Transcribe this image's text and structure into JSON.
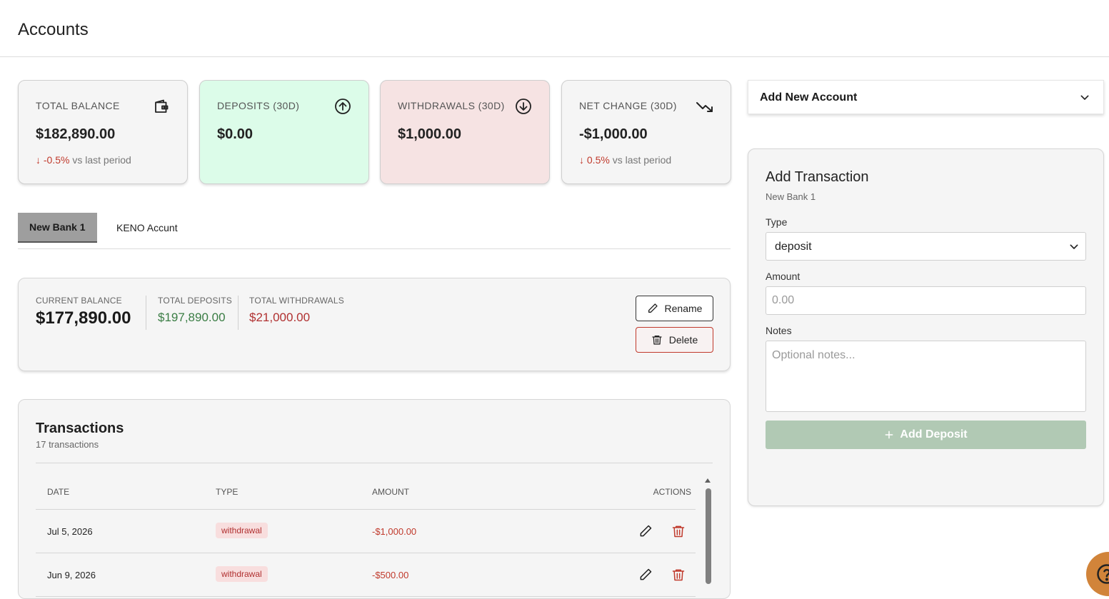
{
  "header": {
    "title": "Accounts"
  },
  "stats": [
    {
      "label": "TOTAL BALANCE",
      "value": "$182,890.00",
      "change_arrow": "↓",
      "change_value": "-0.5%",
      "change_suffix": "vs last period",
      "icon": "wallet-icon"
    },
    {
      "label": "DEPOSITS (30D)",
      "value": "$0.00",
      "icon": "arrow-up-circle-icon",
      "bg": "#dcfce9"
    },
    {
      "label": "WITHDRAWALS (30D)",
      "value": "$1,000.00",
      "icon": "arrow-down-circle-icon",
      "bg": "#f6e3e3"
    },
    {
      "label": "NET CHANGE (30D)",
      "value": "-$1,000.00",
      "change_arrow": "↓",
      "change_value": "0.5%",
      "change_suffix": "vs last period",
      "icon": "trending-down-icon"
    }
  ],
  "tabs": [
    {
      "label": "New Bank 1",
      "active": true
    },
    {
      "label": "KENO Accunt",
      "active": false
    }
  ],
  "account": {
    "current_balance_label": "CURRENT BALANCE",
    "current_balance": "$177,890.00",
    "total_deposits_label": "TOTAL DEPOSITS",
    "total_deposits": "$197,890.00",
    "total_withdrawals_label": "TOTAL WITHDRAWALS",
    "total_withdrawals": "$21,000.00",
    "rename_label": "Rename",
    "delete_label": "Delete"
  },
  "transactions": {
    "title": "Transactions",
    "count": "17 transactions",
    "columns": [
      "DATE",
      "TYPE",
      "AMOUNT",
      "ACTIONS"
    ],
    "rows": [
      {
        "date": "Jul 5, 2026",
        "type": "withdrawal",
        "amount": "-$1,000.00"
      },
      {
        "date": "Jun 9, 2026",
        "type": "withdrawal",
        "amount": "-$500.00"
      }
    ]
  },
  "add_account": {
    "label": "Add New Account"
  },
  "form": {
    "title": "Add Transaction",
    "subtitle": "New Bank 1",
    "type_label": "Type",
    "type_value": "deposit",
    "amount_label": "Amount",
    "amount_placeholder": "0.00",
    "notes_label": "Notes",
    "notes_placeholder": "Optional notes...",
    "submit_label": "Add Deposit"
  },
  "colors": {
    "positive": "#3a7d44",
    "negative": "#c0392b",
    "deposits_card": "#dcfce9",
    "withdrawals_card": "#f6e3e3",
    "submit_disabled": "#b1c9b4",
    "help_button": "#d1843a"
  }
}
